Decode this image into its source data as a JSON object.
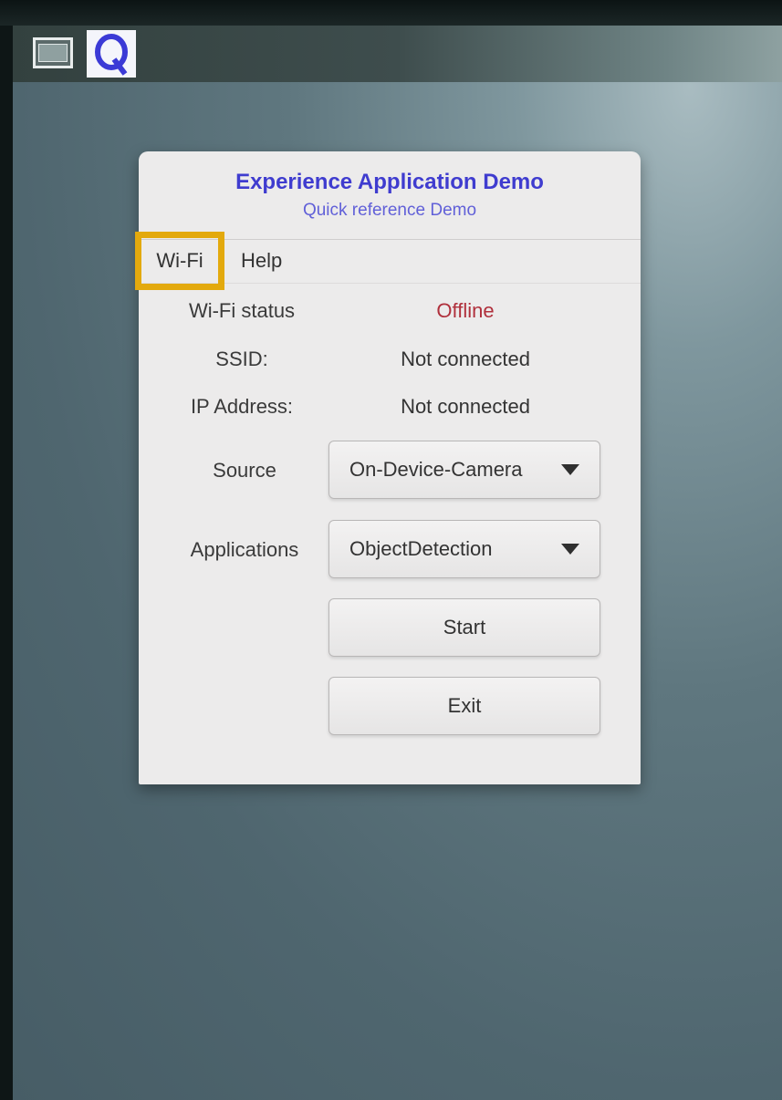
{
  "dialog": {
    "title": "Experience Application Demo",
    "subtitle": "Quick reference Demo"
  },
  "menu": {
    "wifi": "Wi-Fi",
    "help": "Help"
  },
  "status": {
    "wifi_label": "Wi-Fi status",
    "wifi_value": "Offline",
    "ssid_label": "SSID:",
    "ssid_value": "Not connected",
    "ip_label": "IP Address:",
    "ip_value": "Not connected"
  },
  "source": {
    "label": "Source",
    "selected": "On-Device-Camera"
  },
  "applications": {
    "label": "Applications",
    "selected": "ObjectDetection"
  },
  "buttons": {
    "start": "Start",
    "exit": "Exit"
  },
  "icons": {
    "taskbar_app": "terminal-window-icon",
    "taskbar_logo": "q-logo-icon",
    "dropdown": "triangle-down-icon"
  },
  "colors": {
    "title": "#3f3ccf",
    "offline": "#b0303c",
    "highlight": "#e3a90d"
  }
}
